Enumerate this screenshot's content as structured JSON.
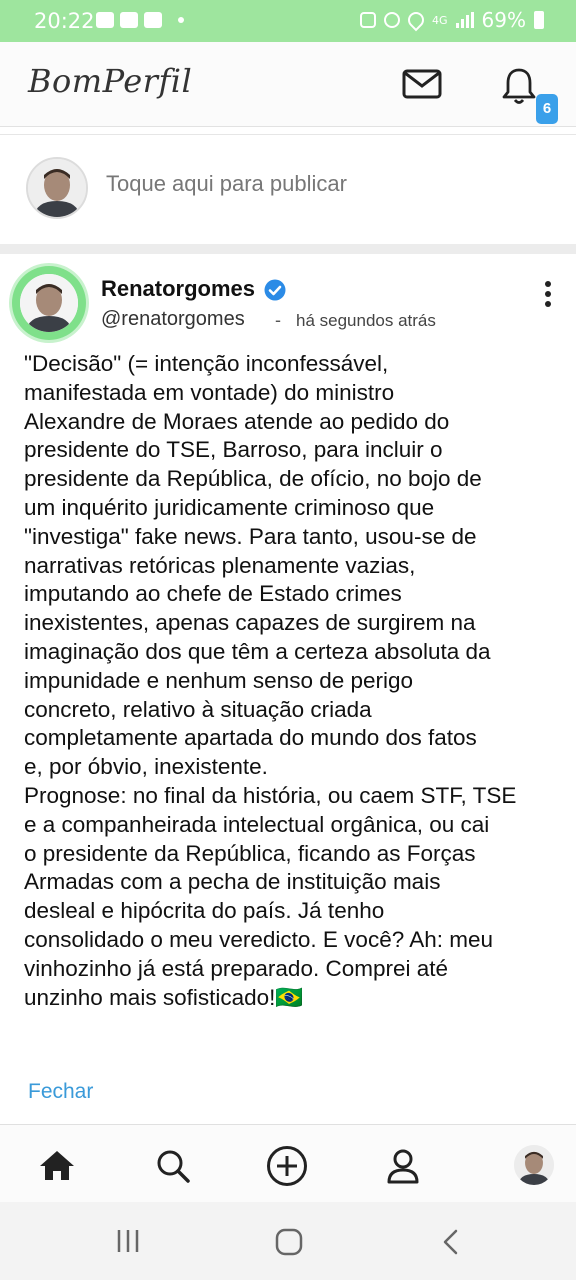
{
  "status_bar": {
    "time": "20:22",
    "battery": "69%",
    "network": "4G"
  },
  "app": {
    "logo": "BomPerfil",
    "notification_count": "6"
  },
  "compose": {
    "placeholder": "Toque aqui para publicar"
  },
  "post": {
    "author_name": "Renatorgomes",
    "handle": "@renatorgomes",
    "separator": "-",
    "time_ago": "há segundos atrás",
    "body": "\"Decisão\" (= intenção inconfessável,\nmanifestada em vontade) do ministro\nAlexandre de Moraes atende ao pedido do\npresidente do TSE, Barroso, para incluir o\npresidente da República, de ofício, no bojo de\num inquérito juridicamente criminoso que\n\"investiga\" fake news. Para tanto, usou-se de\nnarrativas retóricas plenamente vazias,\nimputando ao chefe de Estado crimes\ninexistentes, apenas capazes de surgirem na\nimaginação dos que têm a certeza absoluta da\nimpunidade e nenhum senso de perigo\nconcreto, relativo à situação criada\ncompletamente apartada do mundo dos fatos\ne, por óbvio, inexistente.\nPrognose: no final da história, ou caem STF, TSE\ne a companheirada intelectual orgânica, ou cai\no presidente da República, ficando as Forças\nArmadas com a pecha de instituição mais\ndesleal e hipócrita do país. Já tenho\nconsolidado o meu veredicto. E você? Ah: meu\nvinhozinho já está preparado. Comprei até\nunzinho mais sofisticado!🇧🇷",
    "close_label": "Fechar"
  },
  "colors": {
    "status_bar": "#9ee59e",
    "accent": "#3aa0ea",
    "link": "#3a9ad9",
    "avatar_ring": "#7fe08a"
  },
  "icons": {
    "header": [
      "mail-icon",
      "bell-icon"
    ],
    "bottom_nav": [
      "home-icon",
      "search-icon",
      "add-circle-icon",
      "profile-icon",
      "avatar"
    ],
    "system_nav": [
      "recent-apps-icon",
      "home-circle-icon",
      "back-icon"
    ]
  }
}
